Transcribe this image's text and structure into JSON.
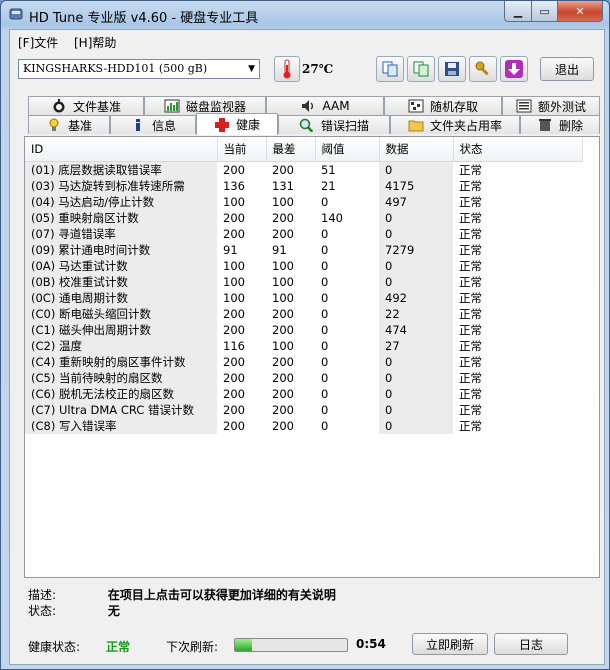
{
  "window": {
    "title": "HD Tune 专业版 v4.60 - 硬盘专业工具"
  },
  "menu": {
    "file": "[F]文件",
    "help": "[H]帮助"
  },
  "toolbar": {
    "drive": "KINGSHARKS-HDD101  (500 gB)",
    "temperature": "27℃",
    "exit_label": "退出"
  },
  "tabs_top": [
    "文件基准",
    "磁盘监视器",
    "AAM",
    "随机存取",
    "额外测试"
  ],
  "tabs_bottom": [
    "基准",
    "信息",
    "健康",
    "错误扫描",
    "文件夹占用率",
    "删除"
  ],
  "active_tab": "健康",
  "table": {
    "headers": [
      "ID",
      "当前",
      "最差",
      "阈值",
      "数据",
      "状态"
    ],
    "rows": [
      {
        "id": "(01) 底层数据读取错误率",
        "current": "200",
        "worst": "200",
        "threshold": "51",
        "data": "0",
        "status": "正常"
      },
      {
        "id": "(03) 马达旋转到标准转速所需",
        "current": "136",
        "worst": "131",
        "threshold": "21",
        "data": "4175",
        "status": "正常"
      },
      {
        "id": "(04) 马达启动/停止计数",
        "current": "100",
        "worst": "100",
        "threshold": "0",
        "data": "497",
        "status": "正常"
      },
      {
        "id": "(05) 重映射扇区计数",
        "current": "200",
        "worst": "200",
        "threshold": "140",
        "data": "0",
        "status": "正常"
      },
      {
        "id": "(07) 寻道错误率",
        "current": "200",
        "worst": "200",
        "threshold": "0",
        "data": "0",
        "status": "正常"
      },
      {
        "id": "(09) 累计通电时间计数",
        "current": "91",
        "worst": "91",
        "threshold": "0",
        "data": "7279",
        "status": "正常"
      },
      {
        "id": "(0A) 马达重试计数",
        "current": "100",
        "worst": "100",
        "threshold": "0",
        "data": "0",
        "status": "正常"
      },
      {
        "id": "(0B) 校准重试计数",
        "current": "100",
        "worst": "100",
        "threshold": "0",
        "data": "0",
        "status": "正常"
      },
      {
        "id": "(0C) 通电周期计数",
        "current": "100",
        "worst": "100",
        "threshold": "0",
        "data": "492",
        "status": "正常"
      },
      {
        "id": "(C0) 断电磁头缩回计数",
        "current": "200",
        "worst": "200",
        "threshold": "0",
        "data": "22",
        "status": "正常"
      },
      {
        "id": "(C1) 磁头伸出周期计数",
        "current": "200",
        "worst": "200",
        "threshold": "0",
        "data": "474",
        "status": "正常"
      },
      {
        "id": "(C2) 温度",
        "current": "116",
        "worst": "100",
        "threshold": "0",
        "data": "27",
        "status": "正常"
      },
      {
        "id": "(C4) 重新映射的扇区事件计数",
        "current": "200",
        "worst": "200",
        "threshold": "0",
        "data": "0",
        "status": "正常"
      },
      {
        "id": "(C5) 当前待映射的扇区数",
        "current": "200",
        "worst": "200",
        "threshold": "0",
        "data": "0",
        "status": "正常"
      },
      {
        "id": "(C6) 脱机无法校正的扇区数",
        "current": "200",
        "worst": "200",
        "threshold": "0",
        "data": "0",
        "status": "正常"
      },
      {
        "id": "(C7) Ultra DMA CRC 错误计数",
        "current": "200",
        "worst": "200",
        "threshold": "0",
        "data": "0",
        "status": "正常"
      },
      {
        "id": "(C8) 写入错误率",
        "current": "200",
        "worst": "200",
        "threshold": "0",
        "data": "0",
        "status": "正常"
      }
    ]
  },
  "description": {
    "desc_label": "描述:",
    "desc_value": "在项目上点击可以获得更加详细的有关说明",
    "status_label": "状态:",
    "status_value": "无"
  },
  "footer": {
    "health_label": "健康状态:",
    "health_value": "正常",
    "health_color": "#1a9a1a",
    "refresh_label": "下次刷新:",
    "progress_fraction": 0.15,
    "countdown": "0:54",
    "refresh_button": "立即刷新",
    "log_button": "日志"
  }
}
